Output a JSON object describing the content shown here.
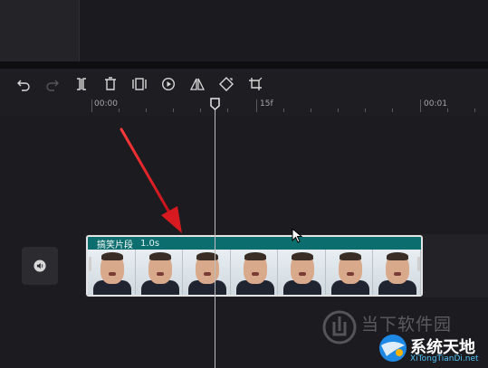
{
  "toolbar": {
    "tools": [
      {
        "name": "undo-icon"
      },
      {
        "name": "redo-icon"
      },
      {
        "name": "split-icon"
      },
      {
        "name": "delete-icon"
      },
      {
        "name": "freeze-frame-icon"
      },
      {
        "name": "playback-icon"
      },
      {
        "name": "mirror-icon"
      },
      {
        "name": "rotate-icon"
      },
      {
        "name": "crop-icon"
      }
    ]
  },
  "ruler": {
    "labels": [
      "00:00",
      "15f",
      "00:01"
    ]
  },
  "clip": {
    "title": "搞笑片段",
    "duration": "1.0s",
    "color": "#0d7a7a"
  },
  "watermark": {
    "site_text": "当下软件园",
    "brand": "系统天地",
    "url": "XiTongTianDi.net"
  },
  "colors": {
    "accent_arrow": "#e0191e",
    "clip_teal": "#0d7a7a",
    "background": "#1e1e22"
  }
}
